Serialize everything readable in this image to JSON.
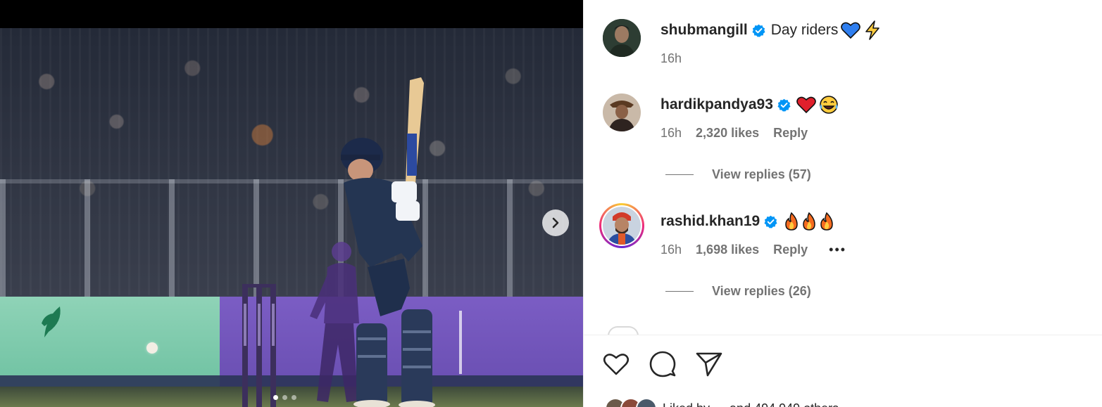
{
  "post": {
    "carousel": {
      "slide_count": 3,
      "active_index": 0,
      "next_icon": "chevron-right-icon"
    },
    "caption": {
      "username": "shubmangill",
      "text": "Day riders",
      "emojis": [
        "blue-heart",
        "lightning"
      ],
      "time": "16h"
    }
  },
  "comments": [
    {
      "username": "hardikpandya93",
      "verified": true,
      "emojis": [
        "red-heart",
        "tears-of-joy"
      ],
      "time": "16h",
      "likes": "2,320 likes",
      "reply_label": "Reply",
      "view_replies": "View replies (57)"
    },
    {
      "username": "rashid.khan19",
      "verified": true,
      "emojis": [
        "fire",
        "fire",
        "fire"
      ],
      "time": "16h",
      "likes": "1,698 likes",
      "reply_label": "Reply",
      "more_label": "•••",
      "view_replies": "View replies (26)"
    }
  ],
  "actions": {
    "like_icon": "heart-icon",
    "comment_icon": "comment-icon",
    "share_icon": "send-icon"
  },
  "liked_by": {
    "text": "Liked by … and 494,949 others"
  },
  "colors": {
    "verified": "#0095f6",
    "text": "#262626",
    "muted": "#737373",
    "story_ring_start": "#f9ce34",
    "story_ring_mid": "#ee2a7b",
    "story_ring_end": "#6228d7"
  }
}
